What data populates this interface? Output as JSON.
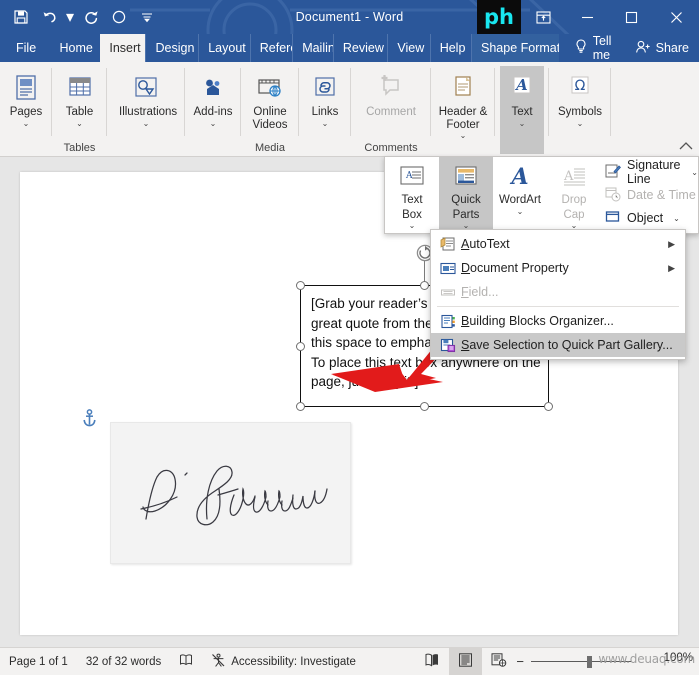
{
  "titlebar": {
    "document_title": "Document1  -  Word",
    "quick_access": [
      {
        "name": "save-icon",
        "label": "Save"
      },
      {
        "name": "undo-icon",
        "label": "Undo"
      },
      {
        "name": "redo-icon",
        "label": "Redo"
      },
      {
        "name": "circle-icon",
        "label": "AutoSave"
      },
      {
        "name": "customize-quick-access-icon",
        "label": "Customize Quick Access Toolbar"
      }
    ],
    "logo_text": "ph",
    "window_buttons": [
      {
        "name": "ribbon-display-options-icon",
        "label": "Ribbon Display Options"
      },
      {
        "name": "minimize-icon",
        "label": "Minimize"
      },
      {
        "name": "maximize-icon",
        "label": "Maximize"
      },
      {
        "name": "close-icon",
        "label": "Close"
      }
    ]
  },
  "tabs": [
    {
      "label": "File",
      "active": false
    },
    {
      "label": "Home",
      "active": false
    },
    {
      "label": "Insert",
      "active": true
    },
    {
      "label": "Design",
      "active": false
    },
    {
      "label": "Layout",
      "active": false
    },
    {
      "label": "Referei",
      "active": false
    },
    {
      "label": "Mailinɡ",
      "active": false
    },
    {
      "label": "Review",
      "active": false
    },
    {
      "label": "View",
      "active": false
    },
    {
      "label": "Help",
      "active": false
    },
    {
      "label": "Shape Format",
      "active": false,
      "contextual": true
    }
  ],
  "tellme": {
    "label": "Tell me"
  },
  "share": {
    "label": "Share"
  },
  "ribbon": {
    "groups": [
      {
        "group_label": "",
        "buttons": [
          {
            "label": "Pages",
            "icon": "pages-icon",
            "caret": true
          }
        ]
      },
      {
        "group_label": "Tables",
        "buttons": [
          {
            "label": "Table",
            "icon": "table-icon",
            "caret": true
          }
        ]
      },
      {
        "group_label": "",
        "buttons": [
          {
            "label": "Illustrations",
            "icon": "illustrations-icon",
            "caret": true
          }
        ]
      },
      {
        "group_label": "",
        "buttons": [
          {
            "label": "Add-ins",
            "icon": "addins-icon",
            "caret": true
          }
        ]
      },
      {
        "group_label": "Media",
        "buttons": [
          {
            "label": "Online Videos",
            "icon": "online-videos-icon",
            "caret": false
          }
        ]
      },
      {
        "group_label": "",
        "buttons": [
          {
            "label": "Links",
            "icon": "links-icon",
            "caret": true
          }
        ]
      },
      {
        "group_label": "Comments",
        "buttons": [
          {
            "label": "Comment",
            "icon": "comment-icon",
            "caret": false,
            "disabled": true
          }
        ]
      },
      {
        "group_label": "",
        "buttons": [
          {
            "label": "Header & Footer",
            "icon": "header-footer-icon",
            "caret": true
          }
        ]
      },
      {
        "group_label": "",
        "buttons": [
          {
            "label": "Text",
            "icon": "text-icon",
            "caret": true,
            "selected": true
          }
        ]
      },
      {
        "group_label": "",
        "buttons": [
          {
            "label": "Symbols",
            "icon": "symbols-icon",
            "caret": true
          }
        ]
      }
    ],
    "collapse_label": "Collapse the Ribbon"
  },
  "text_flyout": {
    "buttons": [
      {
        "label_line1": "Text",
        "label_line2": "Box",
        "icon": "text-box-icon",
        "caret": true,
        "selected": false
      },
      {
        "label_line1": "Quick",
        "label_line2": "Parts",
        "icon": "quick-parts-icon",
        "caret": true,
        "selected": true
      },
      {
        "label_line1": "WordArt",
        "label_line2": "",
        "icon": "wordart-icon",
        "caret": true,
        "selected": false
      },
      {
        "label_line1": "Drop",
        "label_line2": "Cap",
        "icon": "drop-cap-icon",
        "caret": true,
        "selected": false,
        "disabled": true
      }
    ],
    "rows": [
      {
        "label": "Signature Line",
        "icon": "signature-line-icon",
        "caret": true,
        "disabled": false
      },
      {
        "label": "Date & Time",
        "icon": "date-time-icon",
        "caret": false,
        "disabled": true
      },
      {
        "label": "Object",
        "icon": "object-icon",
        "caret": true,
        "disabled": false
      }
    ]
  },
  "quick_parts_menu": {
    "items": [
      {
        "label": "AutoText",
        "accel": "A",
        "icon": "autotext-icon",
        "submenu": true,
        "disabled": false,
        "highlighted": false
      },
      {
        "label": "Document Property",
        "accel": "D",
        "icon": "document-property-icon",
        "submenu": true,
        "disabled": false,
        "highlighted": false
      },
      {
        "label": "Field...",
        "accel": "F",
        "icon": "field-icon",
        "submenu": false,
        "disabled": true,
        "highlighted": false
      },
      {
        "label": "Building Blocks Organizer...",
        "accel": "B",
        "icon": "building-blocks-organizer-icon",
        "submenu": false,
        "disabled": false,
        "highlighted": false
      },
      {
        "label": "Save Selection to Quick Part Gallery...",
        "accel": "S",
        "icon": "save-selection-icon",
        "submenu": false,
        "disabled": false,
        "highlighted": true
      }
    ]
  },
  "document": {
    "text_box": {
      "content": "[Grab your reader’s attention with a great quote from the document or use this space to emphasize a key point. To place this text box anywhere on the page, just drag it.]"
    },
    "signature_image": {
      "alt": "D. Sparrow handwritten signature"
    },
    "anchor": {
      "name": "object-anchor-icon"
    }
  },
  "status_bar": {
    "page": "Page 1 of 1",
    "words": "32 of 32 words",
    "proofing": "",
    "accessibility": "Accessibility: Investigate",
    "view_buttons": [
      {
        "name": "read-mode-icon",
        "label": "Read Mode"
      },
      {
        "name": "print-layout-icon",
        "label": "Print Layout",
        "active": true
      },
      {
        "name": "web-layout-icon",
        "label": "Web Layout"
      }
    ],
    "zoom_out": "−",
    "zoom_in": "+",
    "zoom_level": "100%"
  },
  "watermark": {
    "text": "www.deuaq.com"
  },
  "colors": {
    "title_blue": "#2b579a",
    "ribbon_bg": "#f3f2f1",
    "accent_icon_blue": "#2b579a",
    "selected_gray": "#c6c6c6",
    "arrow_red": "#e21b1b",
    "doc_bg": "#e6e6e6"
  }
}
